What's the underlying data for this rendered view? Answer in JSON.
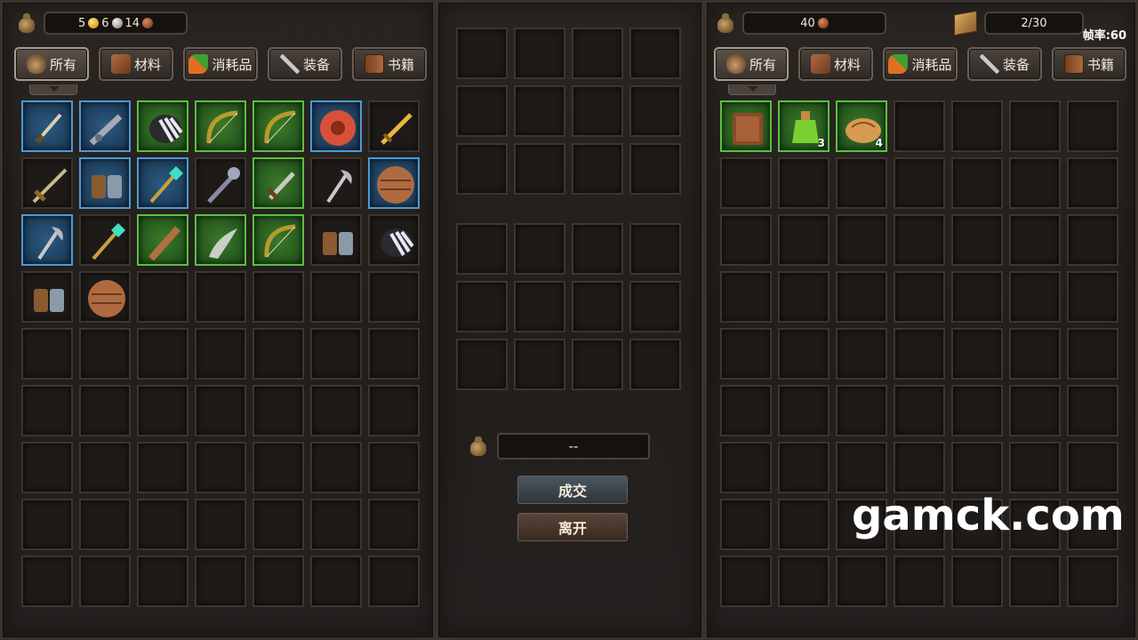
{
  "left": {
    "money": {
      "gold": "5",
      "silver": "6",
      "copper": "14"
    },
    "tabs": [
      {
        "label": "所有",
        "icon": "bag-icon"
      },
      {
        "label": "材料",
        "icon": "wood-icon"
      },
      {
        "label": "消耗品",
        "icon": "carrot-icon"
      },
      {
        "label": "装备",
        "icon": "sword-icon"
      },
      {
        "label": "书籍",
        "icon": "book-icon"
      }
    ],
    "items": [
      {
        "name": "dagger",
        "rarity": "blue"
      },
      {
        "name": "spear-head",
        "rarity": "blue"
      },
      {
        "name": "claw-gloves",
        "rarity": "green"
      },
      {
        "name": "bow",
        "rarity": "green"
      },
      {
        "name": "bow",
        "rarity": "green"
      },
      {
        "name": "round-shield",
        "rarity": "blue"
      },
      {
        "name": "golden-sword",
        "rarity": "dark"
      },
      {
        "name": "longsword",
        "rarity": "dark"
      },
      {
        "name": "gauntlets",
        "rarity": "blue"
      },
      {
        "name": "magic-staff",
        "rarity": "blue"
      },
      {
        "name": "mace",
        "rarity": "dark"
      },
      {
        "name": "short-sword",
        "rarity": "green"
      },
      {
        "name": "axe",
        "rarity": "dark"
      },
      {
        "name": "wooden-shield",
        "rarity": "blue"
      },
      {
        "name": "axe",
        "rarity": "blue"
      },
      {
        "name": "magic-staff",
        "rarity": "dark"
      },
      {
        "name": "wooden-club",
        "rarity": "green"
      },
      {
        "name": "curved-blade",
        "rarity": "green"
      },
      {
        "name": "bow",
        "rarity": "green"
      },
      {
        "name": "gauntlets",
        "rarity": "dark"
      },
      {
        "name": "claw-gloves",
        "rarity": "dark"
      },
      {
        "name": "gauntlets",
        "rarity": "dark"
      },
      {
        "name": "wooden-shield",
        "rarity": "dark"
      }
    ]
  },
  "trade": {
    "price": "--",
    "deal_label": "成交",
    "leave_label": "离开"
  },
  "right": {
    "money": {
      "copper": "40"
    },
    "capacity": "2/30",
    "fps": "帧率:60",
    "tabs": [
      {
        "label": "所有",
        "icon": "bag-icon"
      },
      {
        "label": "材料",
        "icon": "wood-icon"
      },
      {
        "label": "消耗品",
        "icon": "carrot-icon"
      },
      {
        "label": "装备",
        "icon": "sword-icon"
      },
      {
        "label": "书籍",
        "icon": "book-icon"
      }
    ],
    "items": [
      {
        "name": "book",
        "rarity": "green",
        "qty": ""
      },
      {
        "name": "green-potion",
        "rarity": "green",
        "qty": "3"
      },
      {
        "name": "bread",
        "rarity": "green",
        "qty": "4"
      }
    ]
  },
  "watermark": "gamck.com",
  "colors": {
    "rare_blue": "#4a9ad8",
    "uncommon_green": "#5ac040",
    "slot_bg": "#1e1a18"
  }
}
